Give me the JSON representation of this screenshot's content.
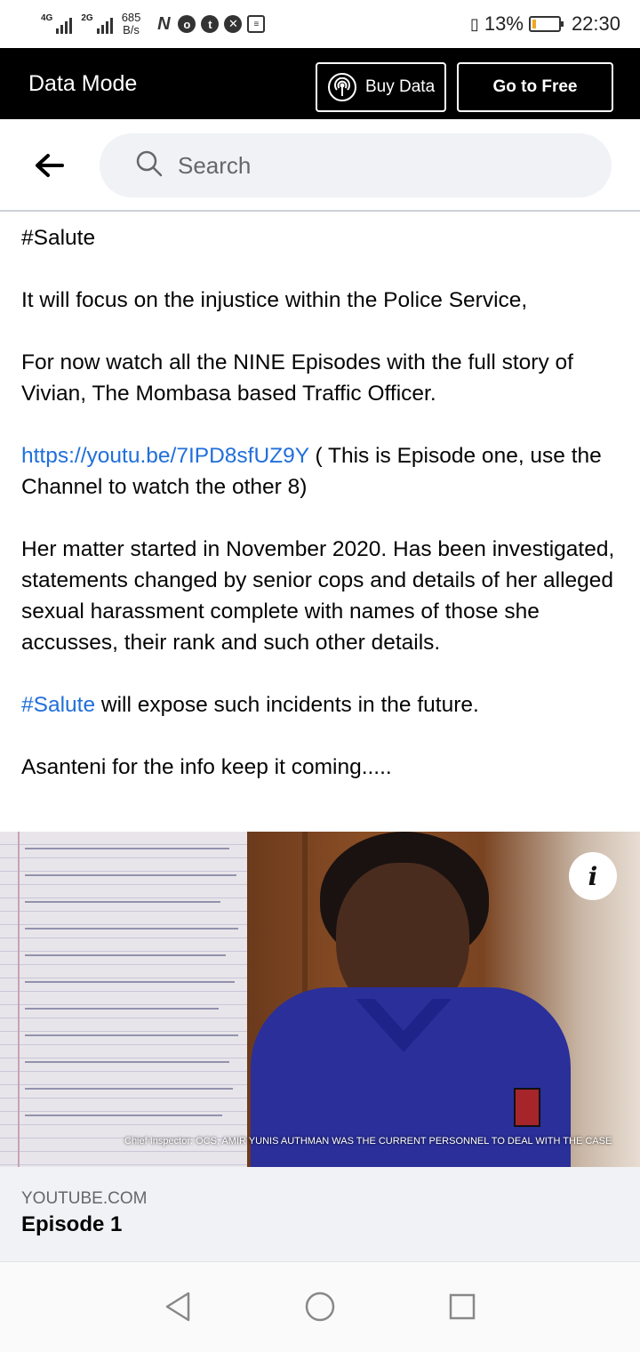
{
  "status_bar": {
    "network_1": "4G",
    "network_2": "2G",
    "speed_value": "685",
    "speed_unit": "B/s",
    "battery": "13%",
    "time": "22:30"
  },
  "data_bar": {
    "title": "Data Mode",
    "buy_label": "Buy Data",
    "free_label": "Go to Free"
  },
  "search": {
    "placeholder": "Search"
  },
  "post": {
    "hashtag_line": "#Salute",
    "para1": "It will focus on the injustice within the Police Service,",
    "para2": "For now watch all the NINE Episodes with the full story of Vivian, The Mombasa based Traffic Officer.",
    "link_url": "https://youtu.be/7IPD8sfUZ9Y",
    "link_suffix": " ( This is Episode one, use the Channel to watch the other 8)",
    "para4": "Her matter started in November 2020. Has been investigated, statements changed by senior cops and details of her alleged sexual harassment complete with names of those she accusses, their rank and such other details.",
    "hashtag_link": "#Salute",
    "para5_suffix": " will expose such incidents in the future.",
    "para6": "Asanteni for the info keep it coming....."
  },
  "preview": {
    "caption": "Chief Inspector: OCS, AMIR YUNIS AUTHMAN WAS THE CURRENT PERSONNEL TO DEAL WITH THE CASE",
    "info_label": "i",
    "domain": "YOUTUBE.COM",
    "title": "Episode 1"
  },
  "icons": {
    "back": "back-arrow-icon",
    "search": "search-icon",
    "antenna": "antenna-icon",
    "info": "info-icon",
    "nav_back": "nav-back-icon",
    "nav_home": "nav-home-icon",
    "nav_recents": "nav-recents-icon"
  },
  "colors": {
    "link": "#216fdb",
    "battery": "#f5a623",
    "data_bar_bg": "#000000"
  }
}
